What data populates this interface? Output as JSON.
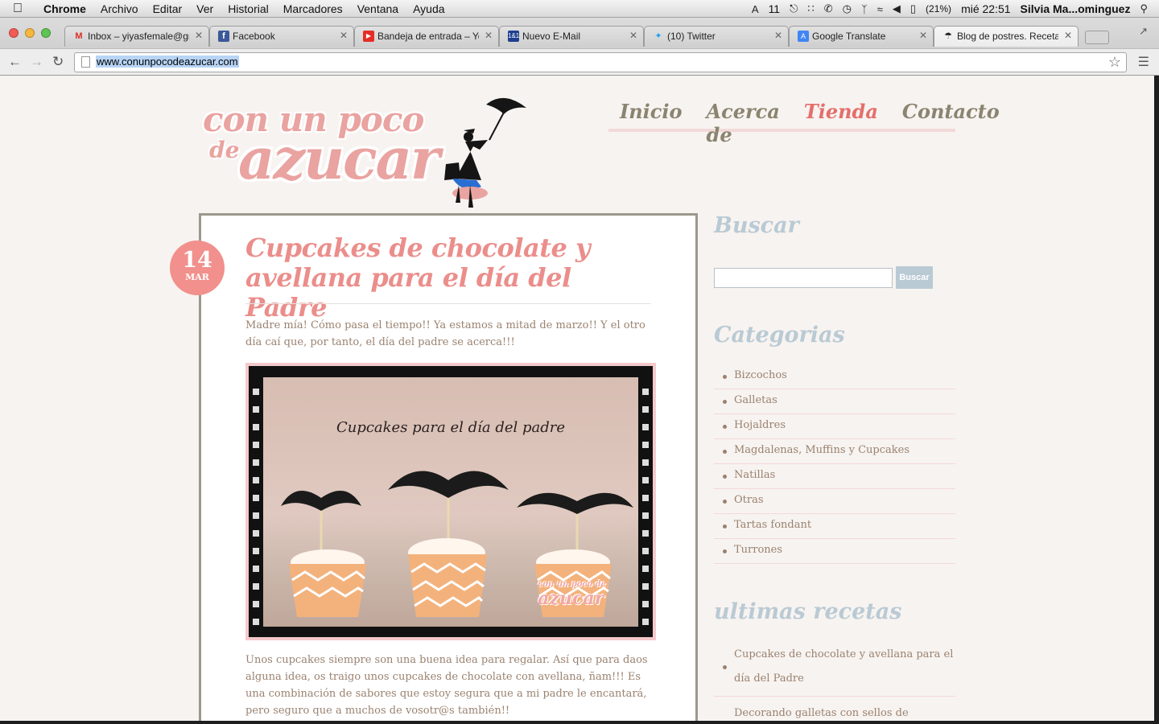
{
  "menubar": {
    "app": "Chrome",
    "items": [
      "Archivo",
      "Editar",
      "Ver",
      "Historial",
      "Marcadores",
      "Ventana",
      "Ayuda"
    ],
    "status": {
      "flash_count": "11",
      "battery": "(21%)",
      "clock": "mié 22:51",
      "user": "Silvia Ma...ominguez"
    }
  },
  "tabs": [
    {
      "title": "Inbox – yiyasfemale@gm",
      "favicon": "gmail-icon",
      "color": "#d93025"
    },
    {
      "title": "Facebook",
      "favicon": "facebook-icon",
      "color": "#3b5998"
    },
    {
      "title": "Bandeja de entrada – You",
      "favicon": "youtube-icon",
      "color": "#e52d27"
    },
    {
      "title": "Nuevo E-Mail",
      "favicon": "mail-icon",
      "color": "#1f3f8f"
    },
    {
      "title": "(10) Twitter",
      "favicon": "twitter-icon",
      "color": "#1da1f2"
    },
    {
      "title": "Google Translate",
      "favicon": "translate-icon",
      "color": "#4285f4"
    },
    {
      "title": "Blog de postres. Recetas",
      "favicon": "umbrella-icon",
      "color": "#333333",
      "active": true
    }
  ],
  "address_bar": {
    "url": "www.conunpocodeazucar.com"
  },
  "site": {
    "logo": {
      "line1": "con un poco",
      "line2": "de",
      "line3": "azucar"
    },
    "nav": [
      {
        "label": "Inicio",
        "current": false
      },
      {
        "label": "Acerca de",
        "current": false
      },
      {
        "label": "Tienda",
        "current": true
      },
      {
        "label": "Contacto",
        "current": false
      }
    ],
    "accent": "#eb8e8b"
  },
  "post": {
    "date_day": "14",
    "date_month": "MAR",
    "title": "Cupcakes de chocolate y avellana para el día del Padre",
    "intro": "Madre mía! Cómo pasa el tiempo!! Ya estamos a mitad de marzo!! Y el otro día caí que, por tanto, el día del padre se acerca!!!",
    "image_caption": "Cupcakes para el día del padre",
    "image_watermark_small": "con un poco de",
    "image_watermark": "azucar",
    "body": "Unos cupcakes siempre son una buena idea para regalar. Así que para daos alguna idea, os traigo unos cupcakes de chocolate con avellana, ñam!!! Es una combinación de sabores que estoy segura que a mi padre le encantará, pero seguro que a muchos de vosotr@s también!!"
  },
  "sidebar": {
    "search_title": "Buscar",
    "search_button": "Buscar",
    "search_value": "",
    "categories_title": "Categorias",
    "categories": [
      "Bizcochos",
      "Galletas",
      "Hojaldres",
      "Magdalenas, Muffins y Cupcakes",
      "Natillas",
      "Otras",
      "Tartas fondant",
      "Turrones"
    ],
    "recent_title": "ultimas recetas",
    "recent": [
      "Cupcakes de chocolate y avellana para el día del Padre",
      "Decorando galletas con sellos de estampar,"
    ]
  }
}
